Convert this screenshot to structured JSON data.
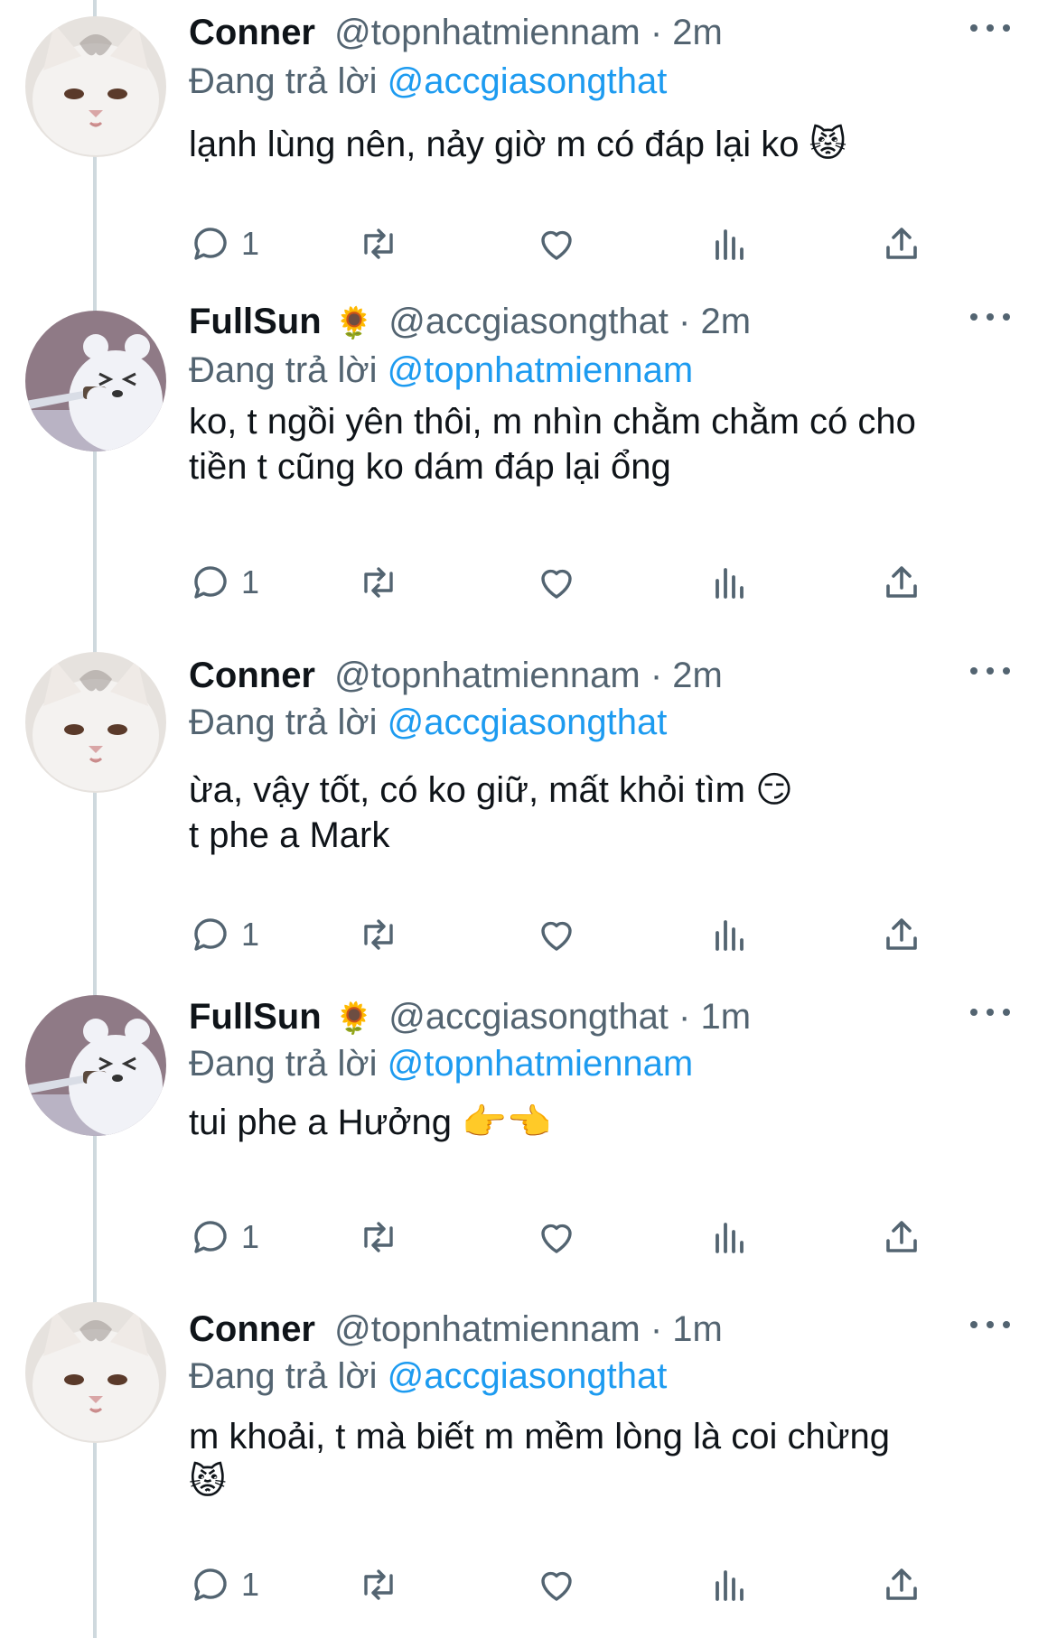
{
  "tweets": [
    {
      "name": "Conner",
      "badge": "",
      "handle": "@topnhatmiennam",
      "dot": "·",
      "time": "2m",
      "replying_prefix": "Đang trả lời",
      "replying_to": "@accgiasongthat",
      "text": "lạnh lùng nên, nảy giờ m có đáp lại ko 😾",
      "reply_count": "1",
      "avatar": "white-cat-avatar"
    },
    {
      "name": "FullSun",
      "badge": "🌻",
      "handle": "@accgiasongthat",
      "dot": "·",
      "time": "2m",
      "replying_prefix": "Đang trả lời",
      "replying_to": "@topnhatmiennam",
      "text": "ko, t ngồi yên thôi, m nhìn chằm chằm có cho\ntiền t cũng ko dám đáp lại ổng",
      "reply_count": "1",
      "avatar": "bear-with-knife-avatar"
    },
    {
      "name": "Conner",
      "badge": "",
      "handle": "@topnhatmiennam",
      "dot": "·",
      "time": "2m",
      "replying_prefix": "Đang trả lời",
      "replying_to": "@accgiasongthat",
      "text": "ừa, vậy tốt, có ko giữ, mất khỏi tìm 😏\nt phe a Mark",
      "reply_count": "1",
      "avatar": "white-cat-avatar"
    },
    {
      "name": "FullSun",
      "badge": "🌻",
      "handle": "@accgiasongthat",
      "dot": "·",
      "time": "1m",
      "replying_prefix": "Đang trả lời",
      "replying_to": "@topnhatmiennam",
      "text": "tui phe a Hưởng 👉👈",
      "reply_count": "1",
      "avatar": "bear-with-knife-avatar"
    },
    {
      "name": "Conner",
      "badge": "",
      "handle": "@topnhatmiennam",
      "dot": "·",
      "time": "1m",
      "replying_prefix": "Đang trả lời",
      "replying_to": "@accgiasongthat",
      "text": "m khoải, t mà biết m mềm lòng là coi chừng\n😾",
      "reply_count": "1",
      "avatar": "white-cat-avatar"
    }
  ],
  "colors": {
    "text": "#0f1419",
    "secondary": "#536471",
    "link": "#1d9bf0",
    "thread_line": "#cfd9de"
  }
}
